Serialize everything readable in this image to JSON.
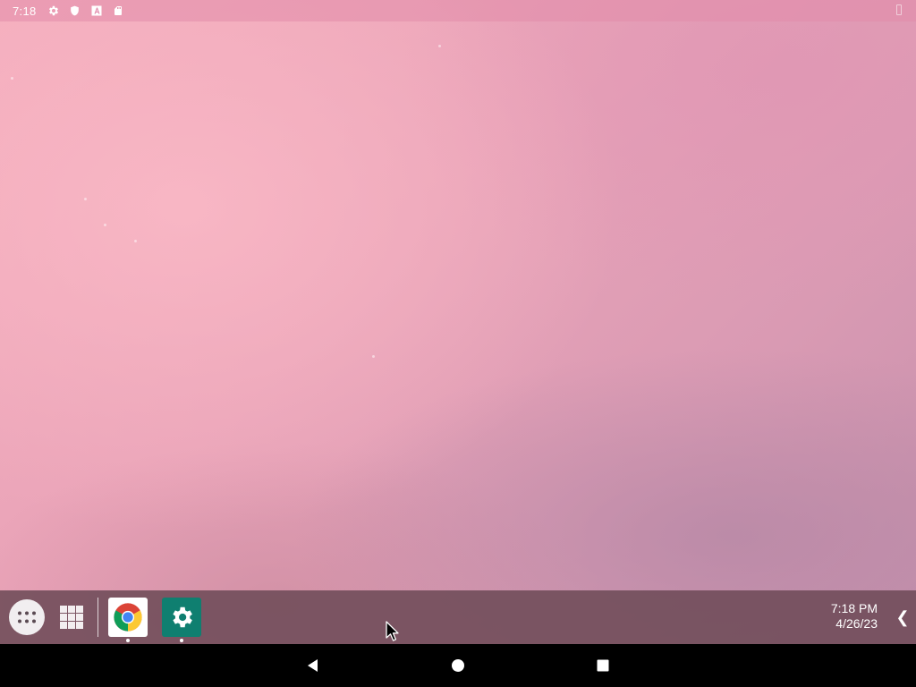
{
  "status_bar": {
    "time": "7:18",
    "icons": [
      "settings-icon",
      "shield-icon",
      "font-a-icon",
      "sd-card-icon"
    ],
    "battery_icon": "battery-icon"
  },
  "taskbar": {
    "app_drawer_icon": "app-drawer-icon",
    "recents_icon": "grid-icon",
    "pinned_apps": [
      {
        "name": "Chrome",
        "icon": "chrome-icon",
        "running": true
      },
      {
        "name": "Settings",
        "icon": "settings-gear-icon",
        "running": true
      }
    ],
    "clock": {
      "time": "7:18 PM",
      "date": "4/26/23"
    },
    "collapse_glyph": "❮"
  },
  "nav_bar": {
    "buttons": [
      "back-icon",
      "home-icon",
      "recents-icon"
    ]
  },
  "colors": {
    "wallpaper": "#e9a6b9",
    "taskbar": "#6e4b58",
    "settings_tile": "#0f7f70",
    "nav_bar": "#000000"
  }
}
